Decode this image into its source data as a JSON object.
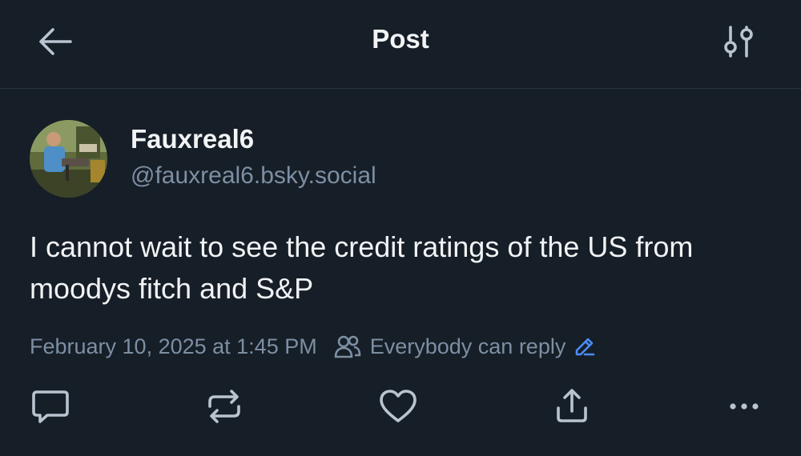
{
  "header": {
    "title": "Post"
  },
  "post": {
    "author_name": "Fauxreal6",
    "author_handle": "@fauxreal6.bsky.social",
    "text": "I cannot wait to see the credit ratings of the US from moodys fitch and S&P",
    "timestamp": "February 10, 2025 at 1:45 PM",
    "reply_setting": "Everybody can reply"
  },
  "icons": {
    "back": "arrow-left-icon",
    "filter": "sliders-icon",
    "reply_setting": "people-icon",
    "edit": "pencil-icon",
    "reply": "comment-icon",
    "repost": "repost-icon",
    "like": "heart-icon",
    "share": "share-icon",
    "more": "ellipsis-icon"
  },
  "colors": {
    "background": "#161e27",
    "text": "#f1f3f5",
    "muted": "#7d8fa3",
    "accent": "#4b8cf5",
    "icon": "#b8c4d0"
  }
}
